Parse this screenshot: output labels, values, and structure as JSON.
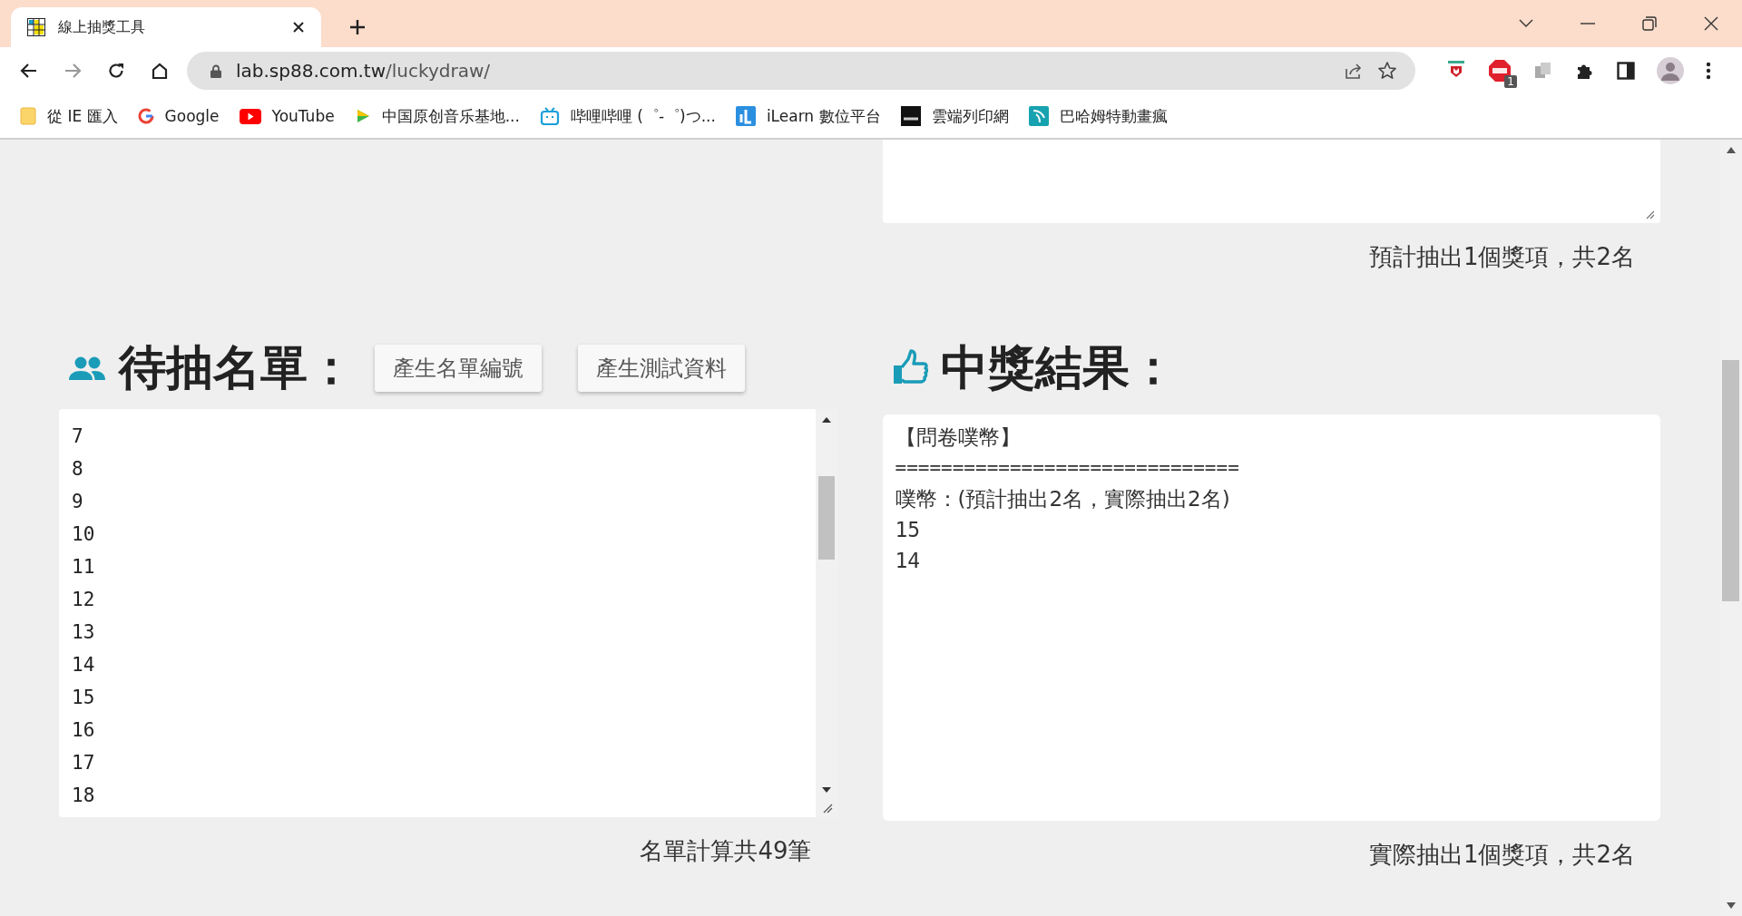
{
  "browser": {
    "tab": {
      "title": "線上抽獎工具",
      "selected": true
    },
    "url": {
      "host": "lab.sp88.com.tw",
      "path": "/luckydraw/"
    },
    "bookmarks": [
      {
        "label": "從 IE 匯入",
        "kind": "folder"
      },
      {
        "label": "Google",
        "kind": "google"
      },
      {
        "label": "YouTube",
        "kind": "youtube"
      },
      {
        "label": "中国原创音乐基地...",
        "kind": "music"
      },
      {
        "label": "哔哩哔哩 (゜-゜)つ...",
        "kind": "bili"
      },
      {
        "label": "iLearn 數位平台",
        "kind": "ilearn"
      },
      {
        "label": "雲端列印網",
        "kind": "ibon"
      },
      {
        "label": "巴哈姆特動畫瘋",
        "kind": "baha"
      }
    ],
    "extension_badge": "1"
  },
  "prize_settings": {
    "summary": "預計抽出1個獎項，共2名"
  },
  "entrants": {
    "title": "待抽名單：",
    "buttons": [
      "產生名單編號",
      "產生測試資料"
    ],
    "lines": [
      "7",
      "8",
      "9",
      "10",
      "11",
      "12",
      "13",
      "14",
      "15",
      "16",
      "17",
      "18"
    ],
    "count": "名單計算共49筆"
  },
  "results": {
    "title": "中獎結果：",
    "lines": [
      "【問卷噗幣】",
      "==============================",
      "噗幣：(預計抽出2名，實際抽出2名)",
      "15",
      "14"
    ],
    "summary": "實際抽出1個獎項，共2名"
  }
}
